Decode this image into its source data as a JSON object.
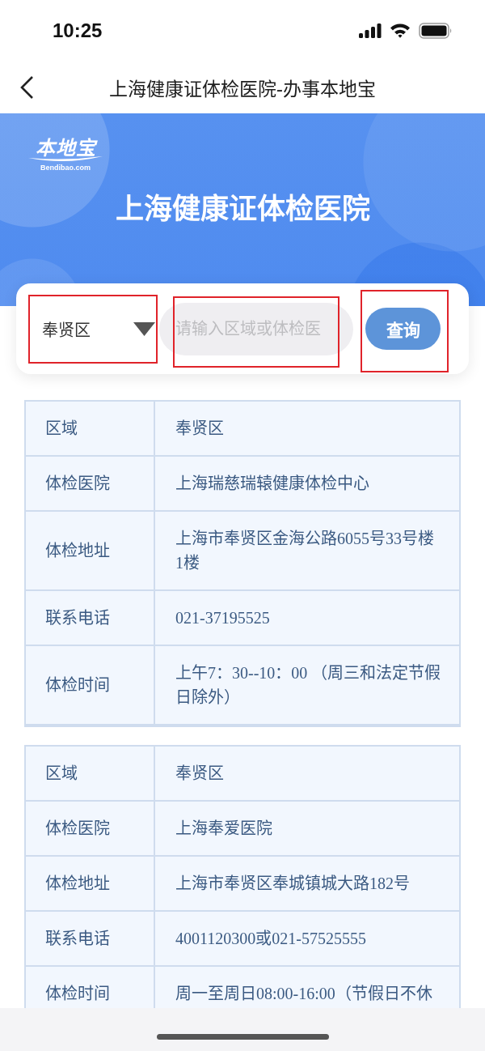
{
  "status_bar": {
    "time": "10:25"
  },
  "nav": {
    "title": "上海健康证体检医院-办事本地宝"
  },
  "banner": {
    "logo": {
      "name": "本地宝",
      "domain": "Bendibao.com"
    },
    "title": "上海健康证体检医院"
  },
  "search": {
    "region": {
      "value": "奉贤区",
      "highlighted": true
    },
    "query": {
      "placeholder": "请输入区域或体检医",
      "highlighted": true
    },
    "button": {
      "label": "查询",
      "highlighted": true
    }
  },
  "tables": [
    {
      "rows": [
        {
          "label": "区域",
          "value": "奉贤区"
        },
        {
          "label": "体检医院",
          "value": "上海瑞慈瑞辕健康体检中心"
        },
        {
          "label": "体检地址",
          "value": "上海市奉贤区金海公路6055号33号楼1楼"
        },
        {
          "label": "联系电话",
          "value": "021-37195525"
        },
        {
          "label": "体检时间",
          "value": "上午7：30--10：00 （周三和法定节假日除外）"
        }
      ]
    },
    {
      "rows": [
        {
          "label": "区域",
          "value": "奉贤区"
        },
        {
          "label": "体检医院",
          "value": "上海奉爱医院"
        },
        {
          "label": "体检地址",
          "value": "上海市奉贤区奉城镇城大路182号"
        },
        {
          "label": "联系电话",
          "value": "4001120300或021-57525555"
        },
        {
          "label": "体检时间",
          "value": "周一至周日08:00-16:00（节假日不休"
        }
      ]
    }
  ]
}
